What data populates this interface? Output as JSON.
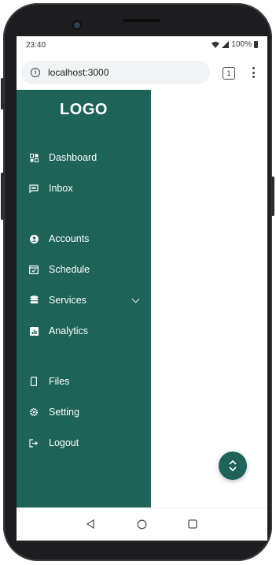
{
  "status_bar": {
    "time": "23:40",
    "battery": "100%"
  },
  "browser": {
    "url": "localhost:3000",
    "tab_count": "1"
  },
  "sidebar": {
    "logo": "LOGO",
    "items": [
      {
        "label": "Dashboard",
        "icon": "dashboard-icon"
      },
      {
        "label": "Inbox",
        "icon": "inbox-icon"
      },
      {
        "label": "Accounts",
        "icon": "account-icon"
      },
      {
        "label": "Schedule",
        "icon": "calendar-icon"
      },
      {
        "label": "Services",
        "icon": "database-icon"
      },
      {
        "label": "Analytics",
        "icon": "analytics-icon"
      },
      {
        "label": "Files",
        "icon": "file-icon"
      },
      {
        "label": "Setting",
        "icon": "gear-icon"
      },
      {
        "label": "Logout",
        "icon": "logout-icon"
      }
    ]
  },
  "colors": {
    "sidebar_bg": "#1d6358",
    "fab_bg": "#1d6358",
    "text": "#ffffff"
  }
}
